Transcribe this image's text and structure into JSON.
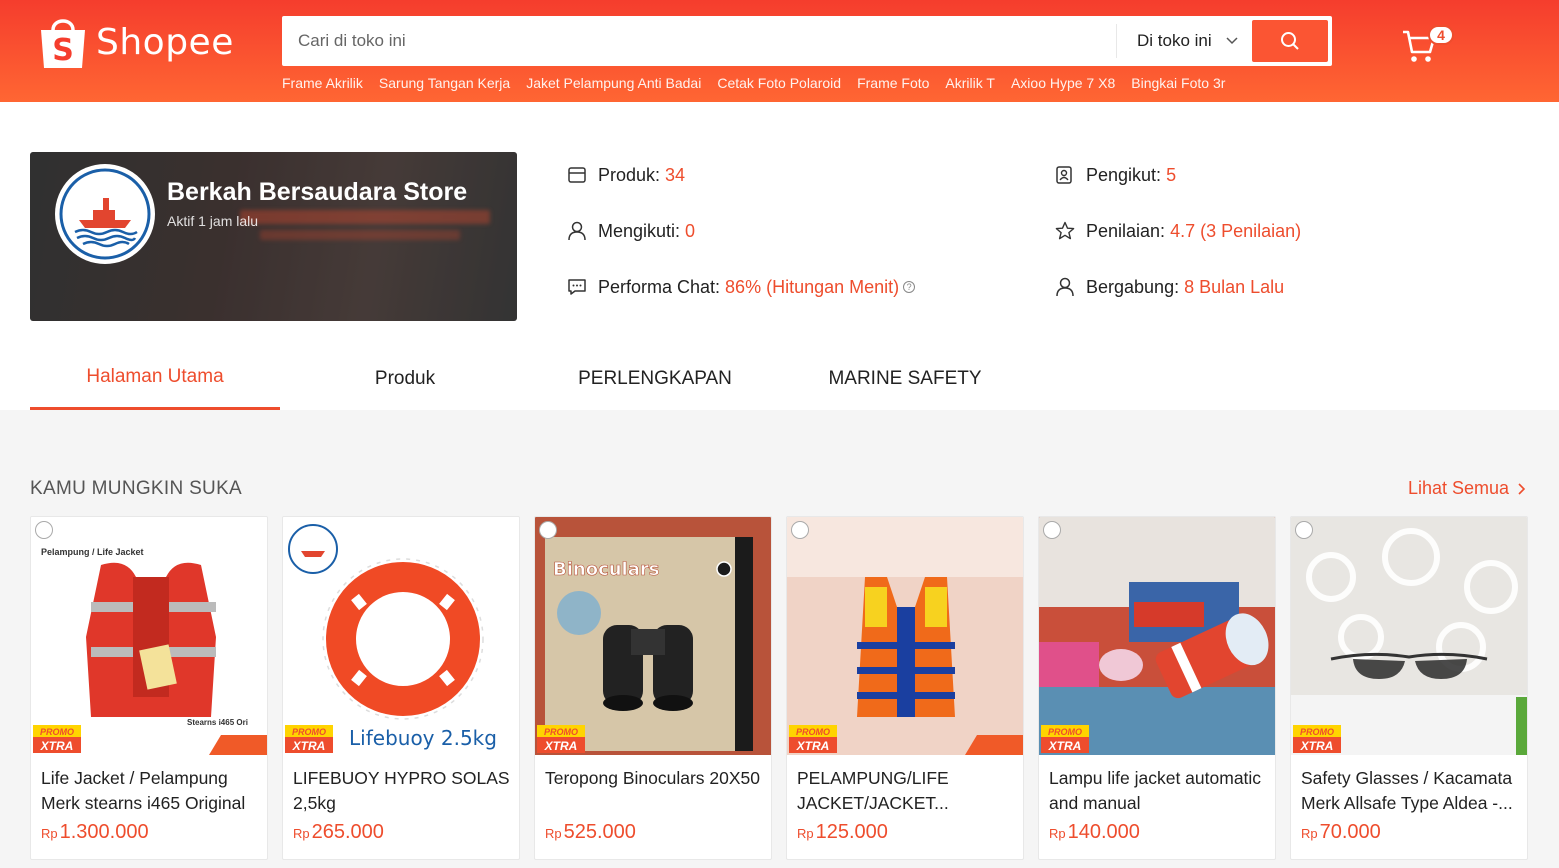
{
  "header": {
    "logo_text": "Shopee",
    "search_placeholder": "Cari di toko ini",
    "search_scope": "Di toko ini",
    "cart_count": "4",
    "suggestions": [
      "Frame Akrilik",
      "Sarung Tangan Kerja",
      "Jaket Pelampung Anti Badai",
      "Cetak Foto Polaroid",
      "Frame Foto",
      "Akrilik T",
      "Axioo Hype 7 X8",
      "Bingkai Foto 3r"
    ]
  },
  "shop": {
    "name": "Berkah Bersaudara Store",
    "status": "Aktif 1 jam lalu",
    "stats": {
      "produk_label": "Produk:",
      "produk_value": "34",
      "pengikut_label": "Pengikut:",
      "pengikut_value": "5",
      "mengikuti_label": "Mengikuti:",
      "mengikuti_value": "0",
      "penilaian_label": "Penilaian:",
      "penilaian_value": "4.7 (3 Penilaian)",
      "chat_label": "Performa Chat:",
      "chat_value": "86% (Hitungan Menit)",
      "bergabung_label": "Bergabung:",
      "bergabung_value": "8 Bulan Lalu"
    }
  },
  "tabs": [
    "Halaman Utama",
    "Produk",
    "PERLENGKAPAN",
    "MARINE SAFETY"
  ],
  "recommend": {
    "title": "KAMU MUNGKIN SUKA",
    "see_all": "Lihat Semua",
    "currency": "Rp",
    "products": [
      {
        "name": "Life Jacket / Pelampung Merk stearns i465 Original",
        "price": "1.300.000"
      },
      {
        "name": "LIFEBUOY HYPRO SOLAS 2,5kg",
        "price": "265.000"
      },
      {
        "name": "Teropong Binoculars 20X50",
        "price": "525.000"
      },
      {
        "name": "PELAMPUNG/LIFE JACKET/JACKET...",
        "price": "125.000"
      },
      {
        "name": "Lampu life jacket automatic and manual",
        "price": "140.000"
      },
      {
        "name": "Safety Glasses / Kacamata Merk Allsafe Type Aldea -...",
        "price": "70.000"
      }
    ],
    "image_texts": {
      "p1_caption": "Pelampung / Life Jacket",
      "p1_model": "Stearns i465 Ori",
      "p2_caption": "Lifebuoy 2.5kg",
      "p3_caption": "Binoculars",
      "promo_top": "PROMO",
      "promo_bottom": "XTRA"
    }
  },
  "colors": {
    "brand": "#ee4d2d",
    "header_start": "#f53d2d",
    "header_end": "#ff6633"
  }
}
